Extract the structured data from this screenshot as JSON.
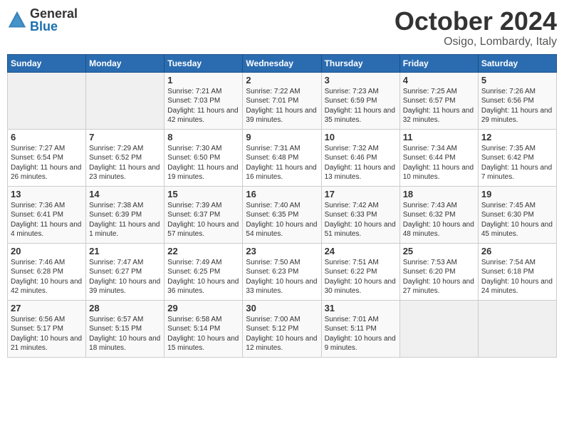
{
  "header": {
    "logo_general": "General",
    "logo_blue": "Blue",
    "month_title": "October 2024",
    "location": "Osigo, Lombardy, Italy"
  },
  "days_of_week": [
    "Sunday",
    "Monday",
    "Tuesday",
    "Wednesday",
    "Thursday",
    "Friday",
    "Saturday"
  ],
  "weeks": [
    [
      {
        "num": "",
        "info": ""
      },
      {
        "num": "",
        "info": ""
      },
      {
        "num": "1",
        "info": "Sunrise: 7:21 AM\nSunset: 7:03 PM\nDaylight: 11 hours and 42 minutes."
      },
      {
        "num": "2",
        "info": "Sunrise: 7:22 AM\nSunset: 7:01 PM\nDaylight: 11 hours and 39 minutes."
      },
      {
        "num": "3",
        "info": "Sunrise: 7:23 AM\nSunset: 6:59 PM\nDaylight: 11 hours and 35 minutes."
      },
      {
        "num": "4",
        "info": "Sunrise: 7:25 AM\nSunset: 6:57 PM\nDaylight: 11 hours and 32 minutes."
      },
      {
        "num": "5",
        "info": "Sunrise: 7:26 AM\nSunset: 6:56 PM\nDaylight: 11 hours and 29 minutes."
      }
    ],
    [
      {
        "num": "6",
        "info": "Sunrise: 7:27 AM\nSunset: 6:54 PM\nDaylight: 11 hours and 26 minutes."
      },
      {
        "num": "7",
        "info": "Sunrise: 7:29 AM\nSunset: 6:52 PM\nDaylight: 11 hours and 23 minutes."
      },
      {
        "num": "8",
        "info": "Sunrise: 7:30 AM\nSunset: 6:50 PM\nDaylight: 11 hours and 19 minutes."
      },
      {
        "num": "9",
        "info": "Sunrise: 7:31 AM\nSunset: 6:48 PM\nDaylight: 11 hours and 16 minutes."
      },
      {
        "num": "10",
        "info": "Sunrise: 7:32 AM\nSunset: 6:46 PM\nDaylight: 11 hours and 13 minutes."
      },
      {
        "num": "11",
        "info": "Sunrise: 7:34 AM\nSunset: 6:44 PM\nDaylight: 11 hours and 10 minutes."
      },
      {
        "num": "12",
        "info": "Sunrise: 7:35 AM\nSunset: 6:42 PM\nDaylight: 11 hours and 7 minutes."
      }
    ],
    [
      {
        "num": "13",
        "info": "Sunrise: 7:36 AM\nSunset: 6:41 PM\nDaylight: 11 hours and 4 minutes."
      },
      {
        "num": "14",
        "info": "Sunrise: 7:38 AM\nSunset: 6:39 PM\nDaylight: 11 hours and 1 minute."
      },
      {
        "num": "15",
        "info": "Sunrise: 7:39 AM\nSunset: 6:37 PM\nDaylight: 10 hours and 57 minutes."
      },
      {
        "num": "16",
        "info": "Sunrise: 7:40 AM\nSunset: 6:35 PM\nDaylight: 10 hours and 54 minutes."
      },
      {
        "num": "17",
        "info": "Sunrise: 7:42 AM\nSunset: 6:33 PM\nDaylight: 10 hours and 51 minutes."
      },
      {
        "num": "18",
        "info": "Sunrise: 7:43 AM\nSunset: 6:32 PM\nDaylight: 10 hours and 48 minutes."
      },
      {
        "num": "19",
        "info": "Sunrise: 7:45 AM\nSunset: 6:30 PM\nDaylight: 10 hours and 45 minutes."
      }
    ],
    [
      {
        "num": "20",
        "info": "Sunrise: 7:46 AM\nSunset: 6:28 PM\nDaylight: 10 hours and 42 minutes."
      },
      {
        "num": "21",
        "info": "Sunrise: 7:47 AM\nSunset: 6:27 PM\nDaylight: 10 hours and 39 minutes."
      },
      {
        "num": "22",
        "info": "Sunrise: 7:49 AM\nSunset: 6:25 PM\nDaylight: 10 hours and 36 minutes."
      },
      {
        "num": "23",
        "info": "Sunrise: 7:50 AM\nSunset: 6:23 PM\nDaylight: 10 hours and 33 minutes."
      },
      {
        "num": "24",
        "info": "Sunrise: 7:51 AM\nSunset: 6:22 PM\nDaylight: 10 hours and 30 minutes."
      },
      {
        "num": "25",
        "info": "Sunrise: 7:53 AM\nSunset: 6:20 PM\nDaylight: 10 hours and 27 minutes."
      },
      {
        "num": "26",
        "info": "Sunrise: 7:54 AM\nSunset: 6:18 PM\nDaylight: 10 hours and 24 minutes."
      }
    ],
    [
      {
        "num": "27",
        "info": "Sunrise: 6:56 AM\nSunset: 5:17 PM\nDaylight: 10 hours and 21 minutes."
      },
      {
        "num": "28",
        "info": "Sunrise: 6:57 AM\nSunset: 5:15 PM\nDaylight: 10 hours and 18 minutes."
      },
      {
        "num": "29",
        "info": "Sunrise: 6:58 AM\nSunset: 5:14 PM\nDaylight: 10 hours and 15 minutes."
      },
      {
        "num": "30",
        "info": "Sunrise: 7:00 AM\nSunset: 5:12 PM\nDaylight: 10 hours and 12 minutes."
      },
      {
        "num": "31",
        "info": "Sunrise: 7:01 AM\nSunset: 5:11 PM\nDaylight: 10 hours and 9 minutes."
      },
      {
        "num": "",
        "info": ""
      },
      {
        "num": "",
        "info": ""
      }
    ]
  ]
}
